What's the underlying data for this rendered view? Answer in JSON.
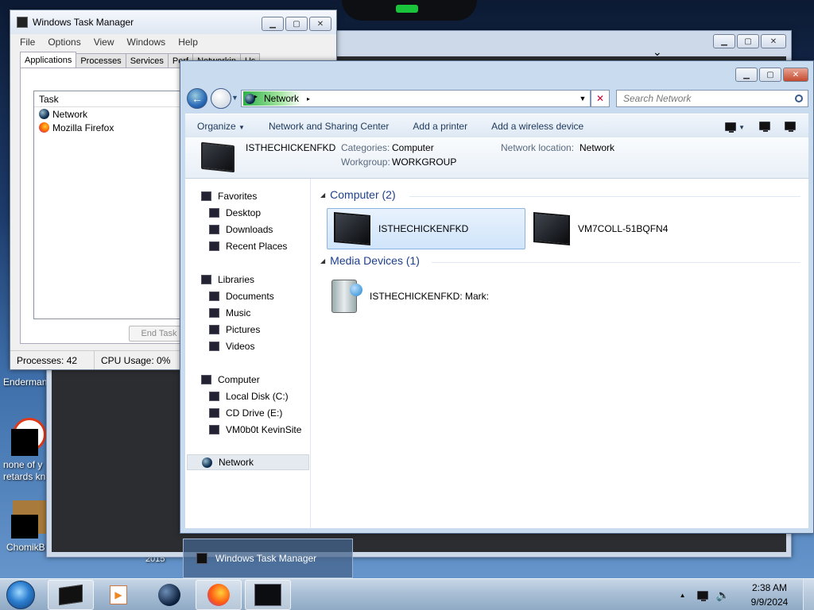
{
  "desktop": {
    "icons": [
      {
        "label": "Enderman"
      },
      {
        "label": "none of y retards kn"
      },
      {
        "label": "ChomikB"
      }
    ],
    "year_label": "2015"
  },
  "task_manager": {
    "title": "Windows Task Manager",
    "menu": [
      "File",
      "Options",
      "View",
      "Windows",
      "Help"
    ],
    "tabs": [
      "Applications",
      "Processes",
      "Services",
      "Perf",
      "Networkin",
      "Us"
    ],
    "column": "Task",
    "tasks": [
      {
        "name": "Network",
        "icon": "globe-icon"
      },
      {
        "name": "Mozilla Firefox",
        "icon": "firefox-icon"
      }
    ],
    "end_task": "End Task",
    "status_processes": "Processes: 42",
    "status_cpu": "CPU Usage: 0%"
  },
  "explorer": {
    "breadcrumb": "Network",
    "search_placeholder": "Search Network",
    "toolbar": {
      "organize": "Organize",
      "network_sharing": "Network and Sharing Center",
      "add_printer": "Add a printer",
      "add_wireless": "Add a wireless device"
    },
    "details": {
      "name": "ISTHECHICKENFKD",
      "categories_label": "Categories:",
      "categories_value": "Computer",
      "workgroup_label": "Workgroup:",
      "workgroup_value": "WORKGROUP",
      "location_label": "Network location:",
      "location_value": "Network"
    },
    "nav": {
      "favorites": "Favorites",
      "desktop": "Desktop",
      "downloads": "Downloads",
      "recent": "Recent Places",
      "libraries": "Libraries",
      "documents": "Documents",
      "music": "Music",
      "pictures": "Pictures",
      "videos": "Videos",
      "computer": "Computer",
      "local_disk": "Local Disk (C:)",
      "cd_drive": "CD Drive (E:)",
      "vm_site": "VM0b0t KevinSite",
      "network": "Network"
    },
    "groups": {
      "computer": "Computer (2)",
      "media": "Media Devices (1)"
    },
    "items": {
      "pc1": "ISTHECHICKENFKD",
      "pc2": "VM7COLL-51BQFN4",
      "media1": "ISTHECHICKENFKD: Mark:"
    }
  },
  "taskbar": {
    "preview_title": "Windows Task Manager",
    "time": "2:38 AM",
    "date": "9/9/2024"
  }
}
